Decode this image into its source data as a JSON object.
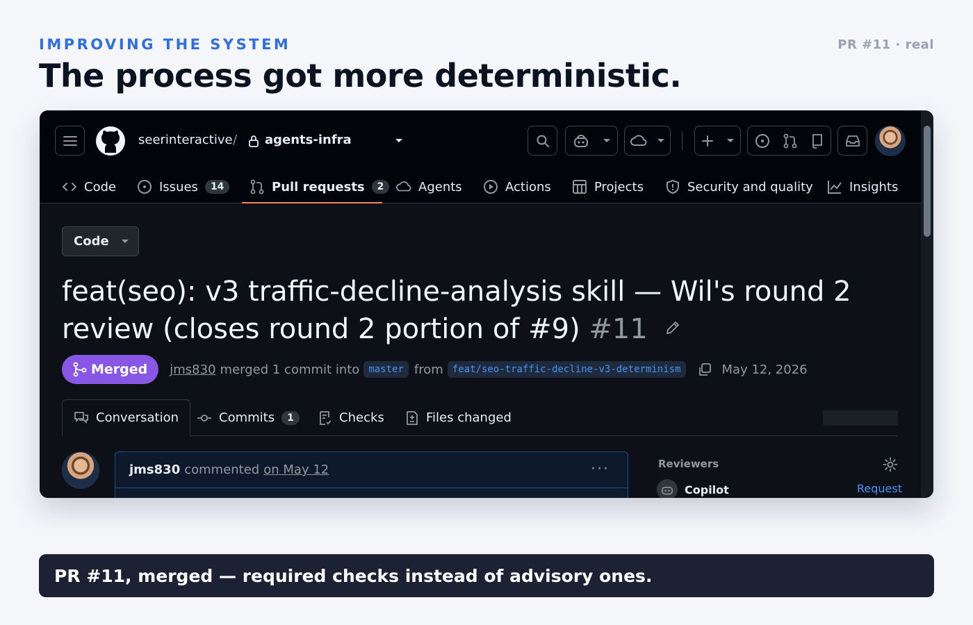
{
  "slide": {
    "eyebrow": "IMPROVING THE SYSTEM",
    "headline": "The process got more deterministic.",
    "pr_tag": "PR #11 · real",
    "caption": "PR #11, merged — required checks instead of advisory ones."
  },
  "github": {
    "breadcrumb": {
      "owner": "seerinteractive",
      "separator": "/",
      "repo": "agents-infra"
    },
    "nav": [
      {
        "label": "Code",
        "icon": "code-icon"
      },
      {
        "label": "Issues",
        "count": "14",
        "icon": "issue-icon"
      },
      {
        "label": "Pull requests",
        "count": "2",
        "icon": "pull-request-icon",
        "active": true
      },
      {
        "label": "Agents",
        "icon": "agents-icon"
      },
      {
        "label": "Actions",
        "icon": "play-icon"
      },
      {
        "label": "Projects",
        "icon": "table-icon"
      },
      {
        "label": "Security and quality",
        "icon": "shield-icon"
      },
      {
        "label": "Insights",
        "icon": "graph-icon"
      }
    ],
    "code_button": "Code",
    "pr": {
      "title": "feat(seo): v3 traffic-decline-analysis skill — Wil's round 2 review (closes round 2 portion of #9)",
      "number": "#11",
      "status": "Merged",
      "author": "jms830",
      "merge_text": "merged 1 commit into",
      "base_branch": "master",
      "from_text": "from",
      "head_branch": "feat/seo-traffic-decline-v3-determinism",
      "date": "May 12, 2026"
    },
    "tabs": [
      {
        "label": "Conversation",
        "icon": "comment-discussion-icon",
        "active": true
      },
      {
        "label": "Commits",
        "count": "1",
        "icon": "commit-icon"
      },
      {
        "label": "Checks",
        "icon": "checklist-icon"
      },
      {
        "label": "Files changed",
        "icon": "file-diff-icon"
      }
    ],
    "comment": {
      "author": "jms830",
      "action": "commented",
      "date": "on May 12"
    },
    "sidebar": {
      "reviewers_label": "Reviewers",
      "reviewer": "Copilot",
      "request_label": "Request"
    }
  },
  "colors": {
    "accent": "#2f6fe0",
    "merged": "#8957e5",
    "link": "#4493f8",
    "tab_underline": "#f78166"
  }
}
